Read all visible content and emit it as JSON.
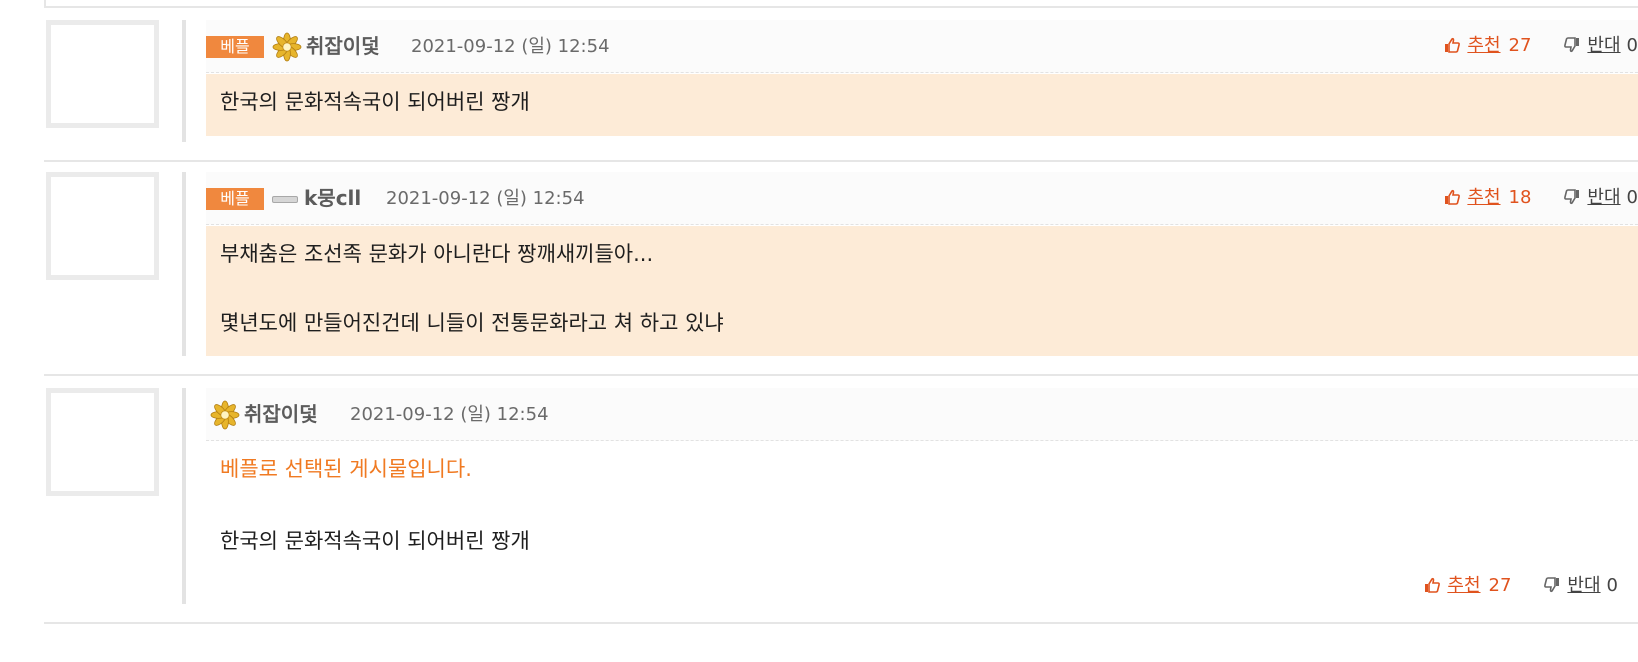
{
  "colors": {
    "best_badge": "#f0883e",
    "highlight_bg": "#fdebd7",
    "upvote": "#e0531e",
    "notice": "#f07a22"
  },
  "comments": [
    {
      "badge": "베플",
      "level_icon": "flower-level-icon",
      "nickname": "취잡이덫",
      "date": "2021-09-12 (일) 12:54",
      "up_label": "추천",
      "up_count": "27",
      "down_label": "반대",
      "down_count": "0",
      "lines": [
        "한국의 문화적속국이 되어버린 짱개"
      ]
    },
    {
      "badge": "베플",
      "level_icon": "bar-level-icon",
      "nickname": "k뭉cll",
      "date": "2021-09-12 (일) 12:54",
      "up_label": "추천",
      "up_count": "18",
      "down_label": "반대",
      "down_count": "0",
      "lines": [
        "부채춤은 조선족 문화가 아니란다 짱깨새끼들아...",
        "몇년도에 만들어진건데 니들이 전통문화라고 쳐 하고 있냐"
      ]
    },
    {
      "level_icon": "flower-level-icon",
      "nickname": "취잡이덫",
      "date": "2021-09-12 (일) 12:54",
      "notice": "베플로 선택된 게시물입니다.",
      "lines": [
        "한국의 문화적속국이 되어버린 짱개"
      ],
      "up_label": "추천",
      "up_count": "27",
      "down_label": "반대",
      "down_count": "0"
    }
  ]
}
